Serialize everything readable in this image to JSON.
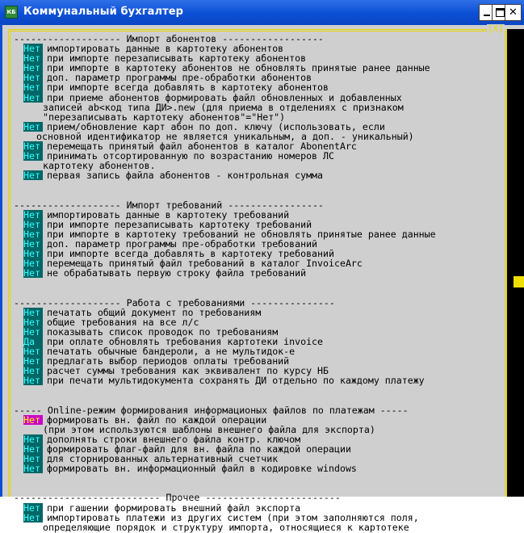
{
  "window": {
    "title": "Коммунальный бухгалтер",
    "icon_label": "КБ",
    "close_glyph": "✕",
    "frame_close": "[X]"
  },
  "sections": [
    {
      "header": "------------------- Импорт абонентов ------------------",
      "rows": [
        {
          "value": "Нет",
          "text": "импортировать данные в картотеку абонентов"
        },
        {
          "value": "Нет",
          "text": "при импорте перезаписывать картотеку абонентов"
        },
        {
          "value": "Нет",
          "text": "при импорте в картотеку абонентов не обновлять принятые ранее данные"
        },
        {
          "value": "Нет",
          "text": "доп. параметр программы пре-обработки абонентов"
        },
        {
          "value": "Нет",
          "text": "при импорте всегда добавлять в картотеку абонентов"
        },
        {
          "value": "Нет",
          "text": "при приеме абонентов формировать файл обновленных и добавленных",
          "cont": [
            "записей ab<код типа ДИ>.new (для приема в отделениях с признаком",
            "\"перезаписывать картотеку абонентов\"=\"Нет\")"
          ]
        },
        {
          "value": "Нет",
          "text": "прием/обновление карт абон по доп. ключу (использовать, если",
          "cont2": [
            "основной идентификатор не является уникальным, а доп. - уникальный)"
          ]
        },
        {
          "value": "Нет",
          "text": "перемещать принятый файл абонентов в каталог AbonentArc"
        },
        {
          "value": "Нет",
          "text": "принимать отсортированную по возрастанию номеров ЛС",
          "cont": [
            "картотеку абонентов."
          ]
        },
        {
          "value": "Нет",
          "text": "первая запись файла абонентов - контрольная сумма"
        }
      ]
    },
    {
      "header": "------------------- Импорт требований -----------------",
      "rows": [
        {
          "value": "Нет",
          "text": "импортировать данные в картотеку требований"
        },
        {
          "value": "Нет",
          "text": "при импорте перезаписывать картотеку требований"
        },
        {
          "value": "Нет",
          "text": "при импорте в картотеку требований не обновлять принятые ранее данные"
        },
        {
          "value": "Нет",
          "text": "доп. параметр программы пре-обработки требований"
        },
        {
          "value": "Нет",
          "text": "при импорте всегда добавлять в картотеку требований"
        },
        {
          "value": "Нет",
          "text": "перемещать принятый файл требований в каталог InvoiceArc"
        },
        {
          "value": "Нет",
          "text": "не обрабатывать первую строку файла требований"
        }
      ]
    },
    {
      "header": "------------------- Работа с требованиями ---------------",
      "rows": [
        {
          "value": "Нет",
          "text": "печатать общий документ по требованиям"
        },
        {
          "value": "Нет",
          "text": "общие требования на все л/с"
        },
        {
          "value": "Нет",
          "text": "показывать список проводок по требованиям"
        },
        {
          "value": "Да",
          "text": "при оплате обновлять требования картотеки invoice"
        },
        {
          "value": "Нет",
          "text": "печатать обычные бандероли, а не мультидок-е"
        },
        {
          "value": "Нет",
          "text": "предлагать выбор периодов оплаты требований"
        },
        {
          "value": "Нет",
          "text": "расчет суммы требования как эквивалент по курсу НБ"
        },
        {
          "value": "Нет",
          "text": "при печати мультидокумента сохранять ДИ отдельно по каждому платежу"
        }
      ]
    },
    {
      "header": "----- Online-режим формирования информационых файлов по платежам -----",
      "rows": [
        {
          "value": "Нет",
          "text": "формировать вн. файл по каждой операции",
          "selected": true,
          "cont": [
            "(при этом используются шаблоны внешнего файла для экспорта)"
          ]
        },
        {
          "value": "Нет",
          "text": "дополнять строки внешнего файла контр. ключом"
        },
        {
          "value": "Нет",
          "text": "формировать флаг-файл для вн. файла по каждой операции"
        },
        {
          "value": "Нет",
          "text": "для сторнированных альтернативный счетчик"
        },
        {
          "value": "Нет",
          "text": "формировать вн. информационный файл в кодировке windows"
        }
      ]
    },
    {
      "header": "-------------------------- Прочее ------------------------",
      "rows": [
        {
          "value": "Нет",
          "text": "при гашении формировать внешний файл экспорта"
        },
        {
          "value": "Нет",
          "text": "импортировать платежи из других систем (при этом заполняются поля,",
          "cont": [
            "определяющие порядок и структуру импорта, относящиеся к картотеке"
          ]
        }
      ]
    }
  ]
}
